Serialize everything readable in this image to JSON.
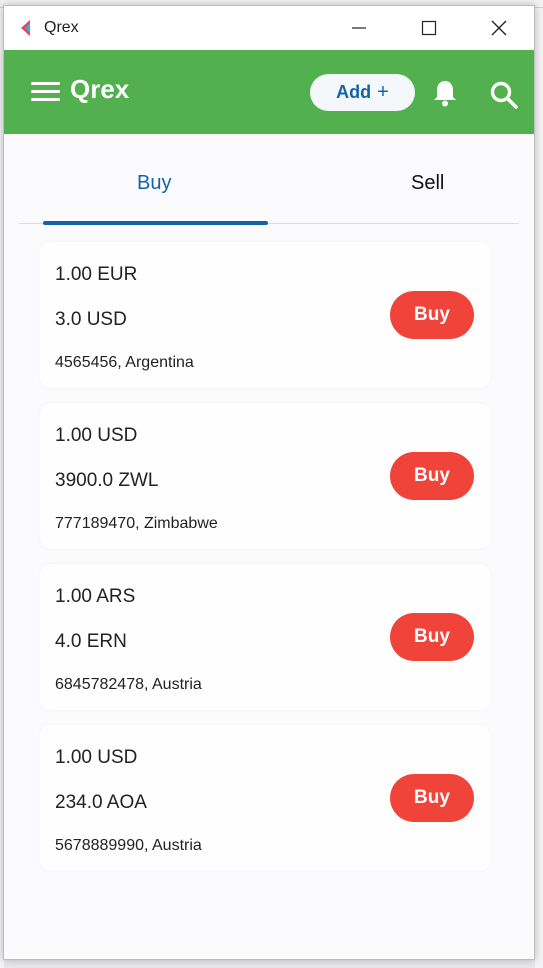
{
  "window": {
    "title": "Qrex"
  },
  "appbar": {
    "brand": "Qrex",
    "add_label": "Add",
    "add_plus": "+"
  },
  "tabs": [
    {
      "label": "Buy",
      "active": true
    },
    {
      "label": "Sell",
      "active": false
    }
  ],
  "offers": [
    {
      "from": "1.00 EUR",
      "to": "3.0 USD",
      "meta": "4565456, Argentina",
      "action": "Buy"
    },
    {
      "from": "1.00 USD",
      "to": "3900.0 ZWL",
      "meta": "777189470, Zimbabwe",
      "action": "Buy"
    },
    {
      "from": "1.00 ARS",
      "to": "4.0 ERN",
      "meta": "6845782478, Austria",
      "action": "Buy"
    },
    {
      "from": "1.00 USD",
      "to": "234.0 AOA",
      "meta": "5678889990, Austria",
      "action": "Buy"
    }
  ],
  "colors": {
    "appbar": "#52b04e",
    "accent": "#1463a8",
    "buy_button": "#f0433a"
  },
  "icons": [
    "app-logo-icon",
    "minimize-icon",
    "maximize-icon",
    "close-icon",
    "menu-icon",
    "bell-icon",
    "search-icon"
  ]
}
